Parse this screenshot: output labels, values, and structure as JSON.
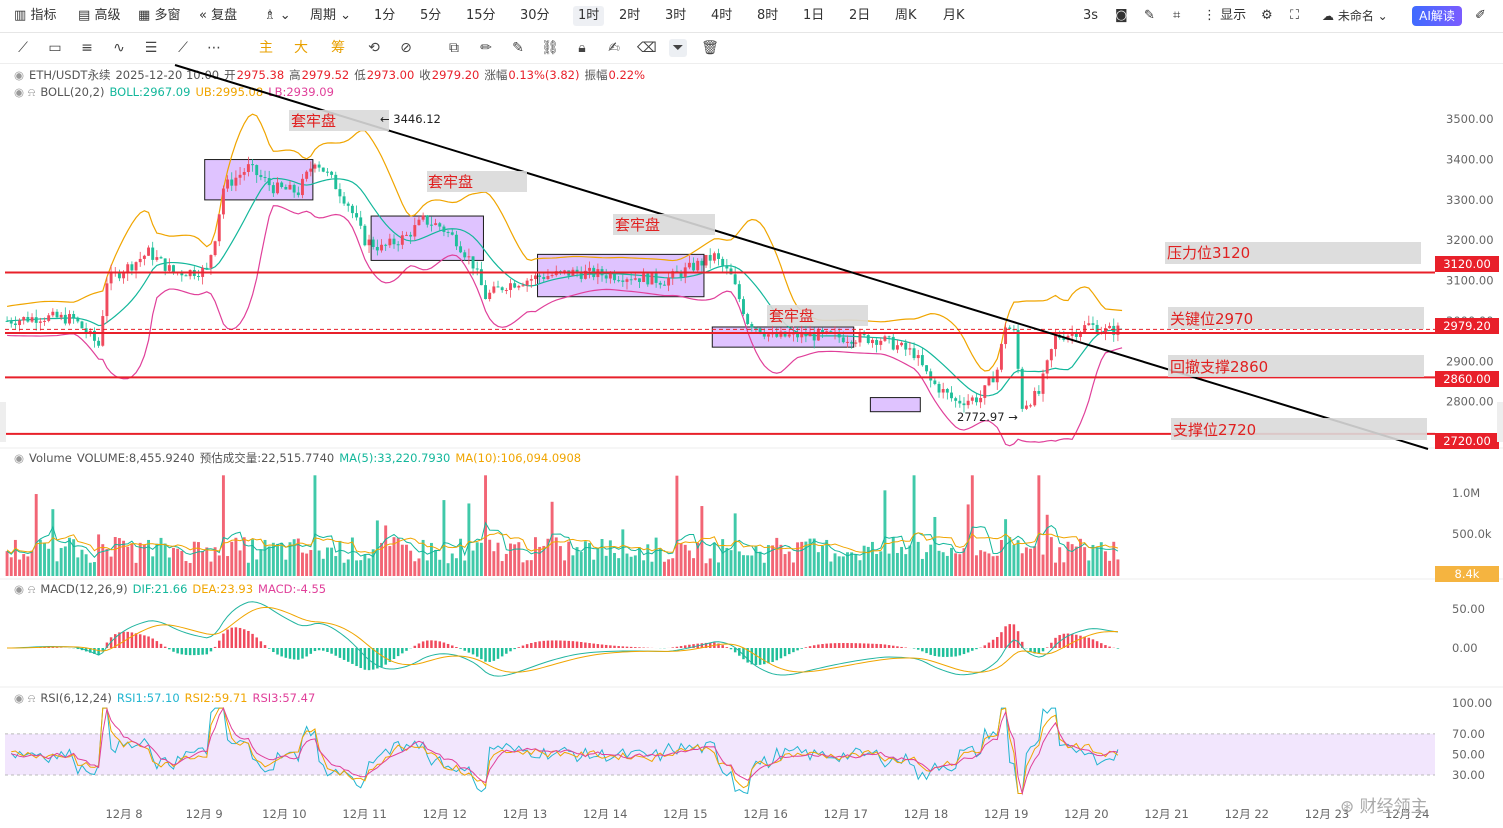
{
  "toolbar": {
    "left": [
      {
        "icon": "indicator-icon",
        "label": "指标"
      },
      {
        "icon": "advanced-icon",
        "label": "高级"
      },
      {
        "icon": "multiwindow-icon",
        "label": "多窗"
      },
      {
        "icon": "replay-icon",
        "label": "复盘"
      },
      {
        "icon": "chart-type-icon",
        "label": ""
      },
      {
        "icon": "",
        "label": "周期"
      }
    ],
    "periods": [
      "1分",
      "5分",
      "15分",
      "30分",
      "1时",
      "2时",
      "3时",
      "4时",
      "8时",
      "1日",
      "2日",
      "周K",
      "月K"
    ],
    "active_period": "1时",
    "right": {
      "interval": "3s",
      "display_label": "显示",
      "layout_name": "未命名",
      "ai_label": "AI解读"
    }
  },
  "drawing_tools": {
    "main": "主",
    "big": "大",
    "chip": "筹"
  },
  "header": {
    "symbol": "ETH/USDT永续",
    "datetime": "2025-12-20 10:00",
    "open_label": "开",
    "open": "2975.38",
    "high_label": "高",
    "high": "2979.52",
    "low_label": "低",
    "low": "2973.00",
    "close_label": "收",
    "close": "2979.20",
    "change_label": "涨幅",
    "change": "0.13%(3.82)",
    "amp_label": "振幅",
    "amp": "0.22%"
  },
  "boll_legend": {
    "name": "BOLL(20,2)",
    "mid": "BOLL:2967.09",
    "ub": "UB:2995.08",
    "lb": "LB:2939.09"
  },
  "volume_legend": {
    "name": "Volume",
    "vol": "VOLUME:8,455.9240",
    "est": "预估成交量:22,515.7740",
    "ma5": "MA(5):33,220.7930",
    "ma10": "MA(10):106,094.0908"
  },
  "macd_legend": {
    "name": "MACD(12,26,9)",
    "dif": "DIF:21.66",
    "dea": "DEA:23.93",
    "macd": "MACD:-4.55"
  },
  "rsi_legend": {
    "name": "RSI(6,12,24)",
    "r1": "RSI1:57.10",
    "r2": "RSI2:59.71",
    "r3": "RSI3:57.47"
  },
  "annotations": {
    "trap": "套牢盘",
    "pressure": "压力位3120",
    "key": "关键位2970",
    "pullback": "回撤支撑2860",
    "support": "支撑位2720",
    "peak": "3446.12",
    "trough": "2772.97"
  },
  "price_tags": {
    "p3120": "3120.00",
    "current": "2979.20",
    "p2860": "2860.00",
    "p2720": "2720.00",
    "vol": "8.4k"
  },
  "watermark": "财经领主",
  "colors": {
    "up": "#f04a5d",
    "down": "#1fbf9a",
    "boll_mid": "#13b79b",
    "boll_ub": "#f0a500",
    "boll_lb": "#e0409a",
    "macd_dif": "#22b5a0",
    "macd_dea": "#f0a500",
    "rsi1": "#22b5d0",
    "rsi2": "#f0a500",
    "rsi3": "#e0409a",
    "level": "#e8202a",
    "trend": "#000000",
    "box": "#c99bff"
  },
  "chart_data": [
    {
      "type": "candlestick",
      "title": "ETH/USDT永续 1时",
      "y_ticks": [
        "3500.00",
        "3400.00",
        "3300.00",
        "3200.00",
        "3100.00",
        "3000.00",
        "2900.00",
        "2800.00"
      ],
      "ylim": [
        2690,
        3560
      ],
      "x_ticks": [
        "12月 8",
        "12月 9",
        "12月 10",
        "12月 11",
        "12月 12",
        "12月 13",
        "12月 14",
        "12月 15",
        "12月 16",
        "12月 17",
        "12月 18",
        "12月 19",
        "12月 20",
        "12月 21",
        "12月 22",
        "12月 23",
        "12月 24"
      ],
      "close_path": [
        [
          0,
          3000
        ],
        [
          8,
          3010
        ],
        [
          16,
          3005
        ],
        [
          22,
          2940
        ],
        [
          24,
          3100
        ],
        [
          30,
          3140
        ],
        [
          34,
          3170
        ],
        [
          40,
          3120
        ],
        [
          48,
          3125
        ],
        [
          50,
          3210
        ],
        [
          52,
          3330
        ],
        [
          58,
          3380
        ],
        [
          64,
          3330
        ],
        [
          70,
          3320
        ],
        [
          74,
          3400
        ],
        [
          78,
          3350
        ],
        [
          82,
          3290
        ],
        [
          86,
          3200
        ],
        [
          90,
          3180
        ],
        [
          96,
          3210
        ],
        [
          100,
          3250
        ],
        [
          104,
          3235
        ],
        [
          108,
          3200
        ],
        [
          112,
          3140
        ],
        [
          115,
          3060
        ],
        [
          120,
          3090
        ],
        [
          128,
          3110
        ],
        [
          136,
          3120
        ],
        [
          144,
          3115
        ],
        [
          150,
          3110
        ],
        [
          158,
          3100
        ],
        [
          164,
          3130
        ],
        [
          170,
          3160
        ],
        [
          174,
          3110
        ],
        [
          178,
          3000
        ],
        [
          184,
          2960
        ],
        [
          192,
          2965
        ],
        [
          200,
          2960
        ],
        [
          210,
          2955
        ],
        [
          218,
          2920
        ],
        [
          222,
          2850
        ],
        [
          228,
          2800
        ],
        [
          234,
          2810
        ],
        [
          238,
          2880
        ],
        [
          240,
          2990
        ],
        [
          242,
          2970
        ],
        [
          244,
          2790
        ],
        [
          248,
          2820
        ],
        [
          252,
          2960
        ],
        [
          256,
          2970
        ],
        [
          260,
          2990
        ],
        [
          264,
          2975
        ],
        [
          268,
          2980
        ]
      ],
      "levels": {
        "pressure": 3120,
        "key": 2970,
        "pullback": 2860,
        "support": 2720,
        "current": 2979.2
      },
      "markers": {
        "high": 3446.12,
        "low": 2772.97
      },
      "trend_line": [
        [
          3560,
          0
        ],
        [
          2690,
          1
        ]
      ]
    },
    {
      "type": "bar",
      "title": "Volume",
      "y_ticks": [
        "1.0M",
        "500.0k"
      ]
    },
    {
      "type": "bar",
      "title": "MACD(12,26,9)",
      "y_ticks": [
        "50.00",
        "0.00"
      ]
    },
    {
      "type": "line",
      "title": "RSI(6,12,24)",
      "y_ticks": [
        "100.00",
        "70.00",
        "50.00",
        "30.00"
      ]
    }
  ]
}
